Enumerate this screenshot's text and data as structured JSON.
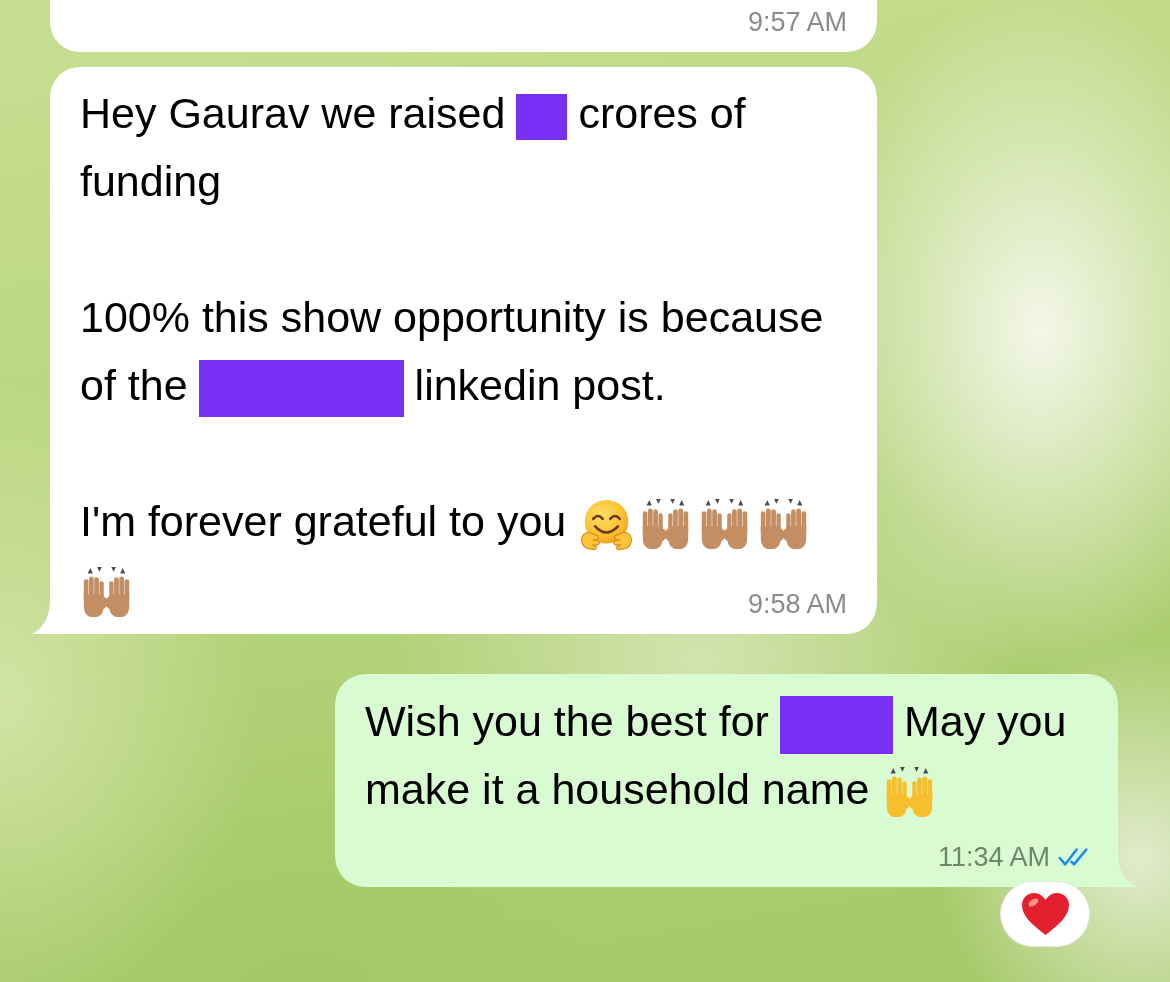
{
  "messages": [
    {
      "outgoing": false,
      "tail": false,
      "time": "9:57 AM"
    },
    {
      "outgoing": false,
      "tail": true,
      "paragraphs": [
        {
          "lines": [
            [
              {
                "kind": "text",
                "text": "Hey Gaurav we raised"
              },
              {
                "kind": "redaction"
              },
              {
                "kind": "text",
                "text": "crores of"
              }
            ],
            [
              {
                "kind": "text",
                "text": "funding"
              }
            ]
          ]
        },
        {
          "lines": [
            [
              {
                "kind": "text",
                "text": "100% this show opportunity is because"
              }
            ],
            [
              {
                "kind": "text",
                "text": "of the"
              },
              {
                "kind": "redaction"
              },
              {
                "kind": "text",
                "text": "linkedin post."
              }
            ]
          ]
        },
        {
          "lines": [
            [
              {
                "kind": "text",
                "text": "I'm forever grateful to you"
              },
              {
                "kind": "hug"
              },
              {
                "kind": "hands",
                "color": "#c38e63"
              },
              {
                "kind": "hands",
                "color": "#c38e63"
              },
              {
                "kind": "hands",
                "color": "#c38e63"
              }
            ],
            [
              {
                "kind": "hands",
                "color": "#c38e63"
              }
            ]
          ]
        }
      ],
      "time": "9:58 AM"
    },
    {
      "outgoing": true,
      "tail": true,
      "paragraphs": [
        {
          "lines": [
            [
              {
                "kind": "text",
                "text": "Wish you the best for"
              },
              {
                "kind": "redaction"
              },
              {
                "kind": "text",
                "text": "May you"
              }
            ],
            [
              {
                "kind": "text",
                "text": "make it a household name"
              },
              {
                "kind": "hands",
                "color": "#f7bf2d"
              }
            ]
          ]
        }
      ],
      "time": "11:34 AM",
      "read": true,
      "reaction": {
        "kind": "heart"
      }
    }
  ]
}
